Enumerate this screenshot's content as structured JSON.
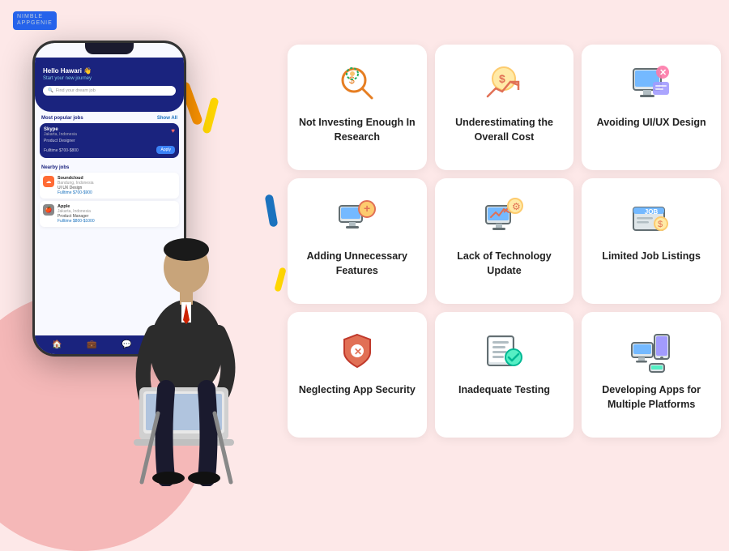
{
  "logo": {
    "line1": "NIMBLE",
    "line2": "APPGENIE"
  },
  "phone": {
    "greeting": "Hello Hawari 👋",
    "subtitle": "Start your new journey",
    "search_placeholder": "Find your dream job",
    "popular_jobs_label": "Most popular jobs",
    "show_all": "Show All",
    "nearby_jobs_label": "Nearby jobs",
    "job1": {
      "company": "Skype",
      "location": "Jakarta, Indonesia",
      "role": "Product Designer",
      "type": "Fulltime",
      "salary": "$700-$800"
    },
    "job2": {
      "company": "Soundcloud",
      "location": "Bandung, Indonesia",
      "role": "UI UX Design",
      "type": "Fulltime",
      "salary": "$700-$900"
    },
    "job3": {
      "company": "Apple",
      "location": "Jakarta, Indonesia",
      "role": "Product Manager",
      "type": "Fulltime",
      "salary": "$800-$1000"
    }
  },
  "cards": [
    {
      "id": "card-research",
      "label": "Not Investing Enough In Research",
      "icon": "research-icon"
    },
    {
      "id": "card-cost",
      "label": "Underestimating the Overall Cost",
      "icon": "cost-icon"
    },
    {
      "id": "card-uiux",
      "label": "Avoiding UI/UX Design",
      "icon": "uiux-icon"
    },
    {
      "id": "card-features",
      "label": "Adding Unnecessary Features",
      "icon": "features-icon"
    },
    {
      "id": "card-tech",
      "label": "Lack of Technology Update",
      "icon": "tech-icon"
    },
    {
      "id": "card-jobs",
      "label": "Limited Job Listings",
      "icon": "jobs-icon"
    },
    {
      "id": "card-security",
      "label": "Neglecting App Security",
      "icon": "security-icon"
    },
    {
      "id": "card-testing",
      "label": "Inadequate Testing",
      "icon": "testing-icon"
    },
    {
      "id": "card-platforms",
      "label": "Developing Apps for Multiple Platforms",
      "icon": "platforms-icon"
    }
  ]
}
